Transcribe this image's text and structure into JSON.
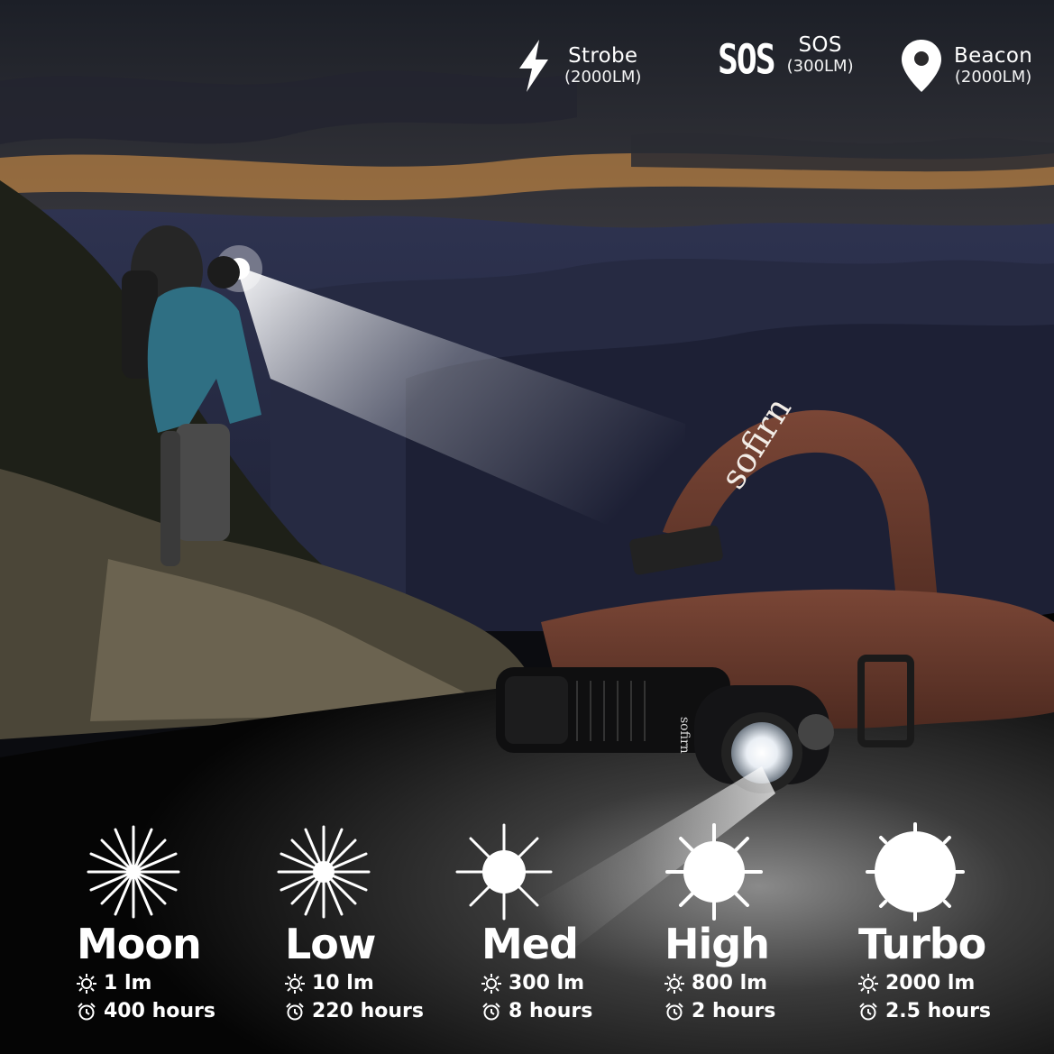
{
  "brand": {
    "strap_text": "sofirn",
    "torch_text": "sofirn"
  },
  "special_modes": [
    {
      "name": "Strobe",
      "output": "(2000LM)",
      "icon": "lightning-bolt-icon"
    },
    {
      "name": "SOS",
      "output": "(300LM)",
      "icon": "sos-text-icon",
      "glyph": "SOS"
    },
    {
      "name": "Beacon",
      "output": "(2000LM)",
      "icon": "map-pin-icon"
    }
  ],
  "levels": [
    {
      "name": "Moon",
      "lumens": "1 lm",
      "runtime": "400 hours",
      "icon": "sun-thin-rays-icon"
    },
    {
      "name": "Low",
      "lumens": "10 lm",
      "runtime": "220 hours",
      "icon": "sun-small-core-icon"
    },
    {
      "name": "Med",
      "lumens": "300 lm",
      "runtime": "8 hours",
      "icon": "sun-medium-core-icon"
    },
    {
      "name": "High",
      "lumens": "800 lm",
      "runtime": "2 hours",
      "icon": "sun-large-core-icon"
    },
    {
      "name": "Turbo",
      "lumens": "2000 lm",
      "runtime": "2.5 hours",
      "icon": "sun-full-disc-icon"
    }
  ],
  "colors": {
    "text": "#ffffff",
    "strap": "#6b3a2c",
    "sky_glow": "#e0863a"
  }
}
